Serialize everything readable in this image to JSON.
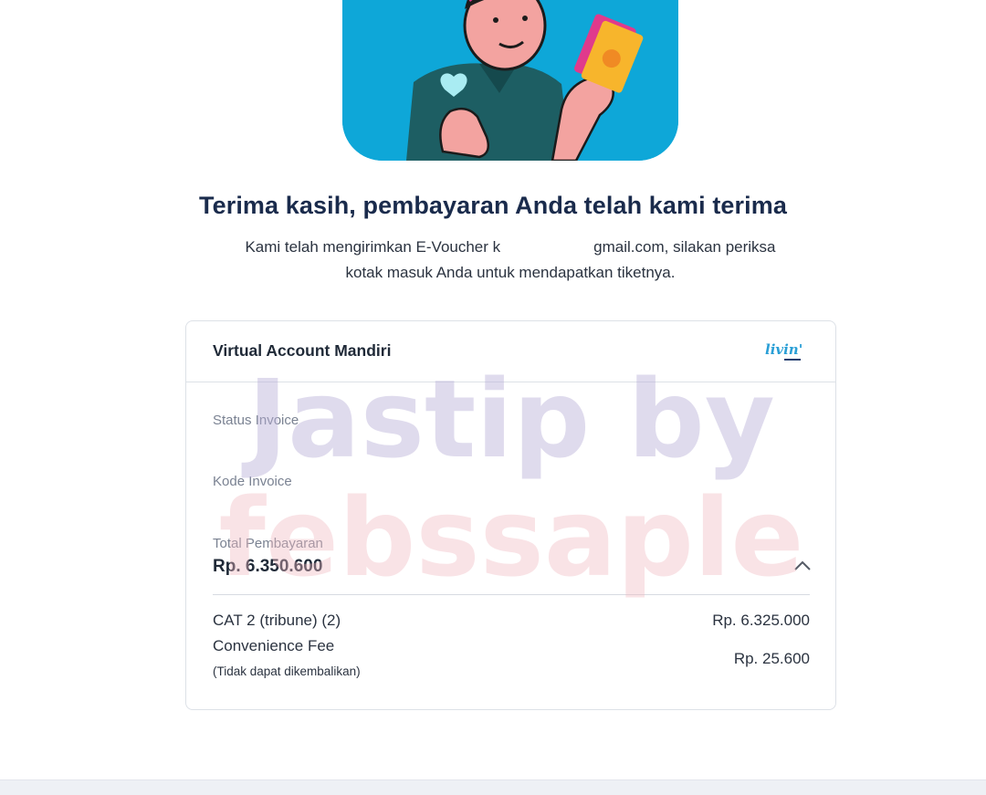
{
  "confirmation": {
    "title": "Terima kasih, pembayaran Anda telah kami terima",
    "message_part1": "Kami telah mengirimkan E-Voucher k",
    "message_part2": "gmail.com, silakan periksa",
    "message_line2": "kotak masuk Anda untuk mendapatkan tiketnya."
  },
  "payment": {
    "method_title": "Virtual Account Mandiri",
    "bank_logo_text": "livin'",
    "status_label": "Status Invoice",
    "code_label": "Kode Invoice",
    "total_label": "Total Pembayaran",
    "total_value": "Rp. 6.350.600",
    "items": [
      {
        "name": "CAT 2 (tribune) (2)",
        "price": "Rp. 6.325.000"
      }
    ],
    "fee_name": "Convenience Fee",
    "fee_note": "(Tidak dapat dikembalikan)",
    "fee_price": "Rp. 25.600"
  },
  "watermark": {
    "line1": "Jastip by",
    "line2": "febssaple"
  },
  "colors": {
    "hero_bg": "#0ea7d8",
    "title": "#1a2b4c",
    "bank_logo": "#2a9fd6"
  }
}
